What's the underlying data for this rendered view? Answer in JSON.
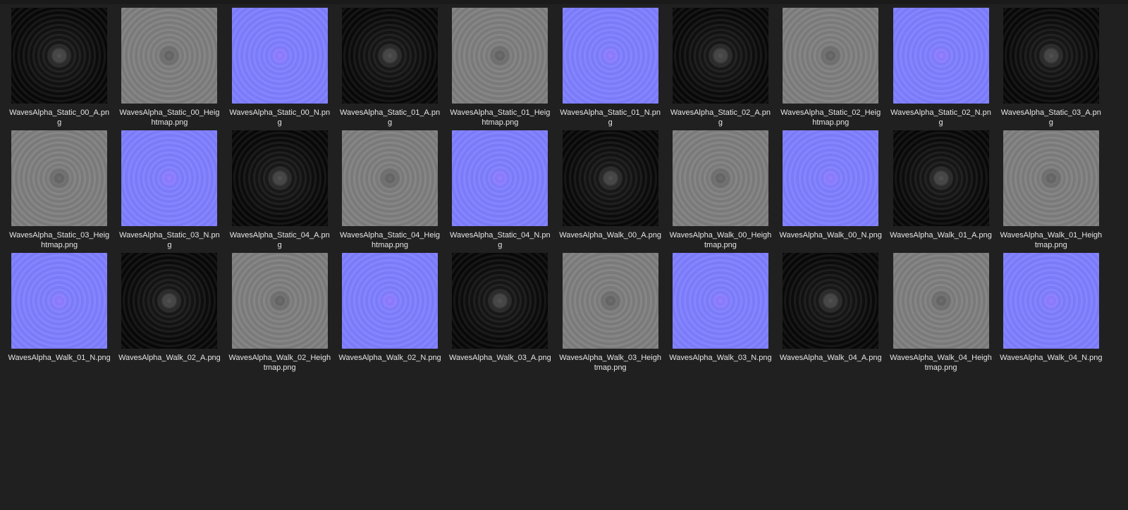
{
  "files": [
    {
      "name": "WavesAlpha_Static_00_A.png",
      "kind": "A"
    },
    {
      "name": "WavesAlpha_Static_00_Heightmap.png",
      "kind": "H"
    },
    {
      "name": "WavesAlpha_Static_00_N.png",
      "kind": "N"
    },
    {
      "name": "WavesAlpha_Static_01_A.png",
      "kind": "A"
    },
    {
      "name": "WavesAlpha_Static_01_Heightmap.png",
      "kind": "H"
    },
    {
      "name": "WavesAlpha_Static_01_N.png",
      "kind": "N"
    },
    {
      "name": "WavesAlpha_Static_02_A.png",
      "kind": "A"
    },
    {
      "name": "WavesAlpha_Static_02_Heightmap.png",
      "kind": "H"
    },
    {
      "name": "WavesAlpha_Static_02_N.png",
      "kind": "N"
    },
    {
      "name": "WavesAlpha_Static_03_A.png",
      "kind": "A"
    },
    {
      "name": "WavesAlpha_Static_03_Heightmap.png",
      "kind": "H"
    },
    {
      "name": "WavesAlpha_Static_03_N.png",
      "kind": "N"
    },
    {
      "name": "WavesAlpha_Static_04_A.png",
      "kind": "A"
    },
    {
      "name": "WavesAlpha_Static_04_Heightmap.png",
      "kind": "H"
    },
    {
      "name": "WavesAlpha_Static_04_N.png",
      "kind": "N"
    },
    {
      "name": "WavesAlpha_Walk_00_A.png",
      "kind": "A"
    },
    {
      "name": "WavesAlpha_Walk_00_Heightmap.png",
      "kind": "H"
    },
    {
      "name": "WavesAlpha_Walk_00_N.png",
      "kind": "N"
    },
    {
      "name": "WavesAlpha_Walk_01_A.png",
      "kind": "A"
    },
    {
      "name": "WavesAlpha_Walk_01_Heightmap.png",
      "kind": "H"
    },
    {
      "name": "WavesAlpha_Walk_01_N.png",
      "kind": "N"
    },
    {
      "name": "WavesAlpha_Walk_02_A.png",
      "kind": "A"
    },
    {
      "name": "WavesAlpha_Walk_02_Heightmap.png",
      "kind": "H"
    },
    {
      "name": "WavesAlpha_Walk_02_N.png",
      "kind": "N"
    },
    {
      "name": "WavesAlpha_Walk_03_A.png",
      "kind": "A"
    },
    {
      "name": "WavesAlpha_Walk_03_Heightmap.png",
      "kind": "H"
    },
    {
      "name": "WavesAlpha_Walk_03_N.png",
      "kind": "N"
    },
    {
      "name": "WavesAlpha_Walk_04_A.png",
      "kind": "A"
    },
    {
      "name": "WavesAlpha_Walk_04_Heightmap.png",
      "kind": "H"
    },
    {
      "name": "WavesAlpha_Walk_04_N.png",
      "kind": "N"
    }
  ]
}
